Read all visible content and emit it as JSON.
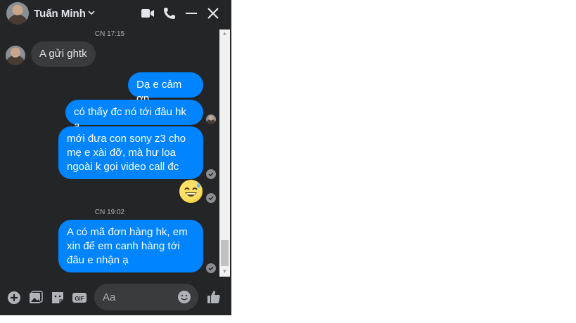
{
  "header": {
    "contact_name": "Tuấn Minh",
    "icons": [
      "video-call-icon",
      "phone-icon",
      "minimize-icon",
      "close-icon"
    ]
  },
  "messages": {
    "timestamp_1": "CN 17:15",
    "incoming_1": "A gửi ghtk",
    "outgoing_1": "Dạ e cảm ơn",
    "outgoing_2": "có thấy đc nó tới đâu hk a",
    "outgoing_3_line1": "mới đưa con sony z3 cho",
    "outgoing_3_line2": "mẹ e xài đỡ, mà hư loa",
    "outgoing_3_line3": "ngoài k gọi video call đc",
    "emoji": "😅",
    "timestamp_2": "CN 19:02",
    "outgoing_4_line1": "A có mã đơn hàng hk, em",
    "outgoing_4_line2": "xin để em canh hàng tới",
    "outgoing_4_line3": "đâu e nhận ạ"
  },
  "composer": {
    "placeholder": "Aa",
    "icons": [
      "add-icon",
      "photo-icon",
      "sticker-icon",
      "gif-icon",
      "emoji-icon",
      "like-icon"
    ]
  },
  "colors": {
    "panel_bg": "#242526",
    "outgoing_bubble": "#0084ff",
    "incoming_bubble": "#3a3b3c",
    "text_light": "#e4e6eb"
  }
}
